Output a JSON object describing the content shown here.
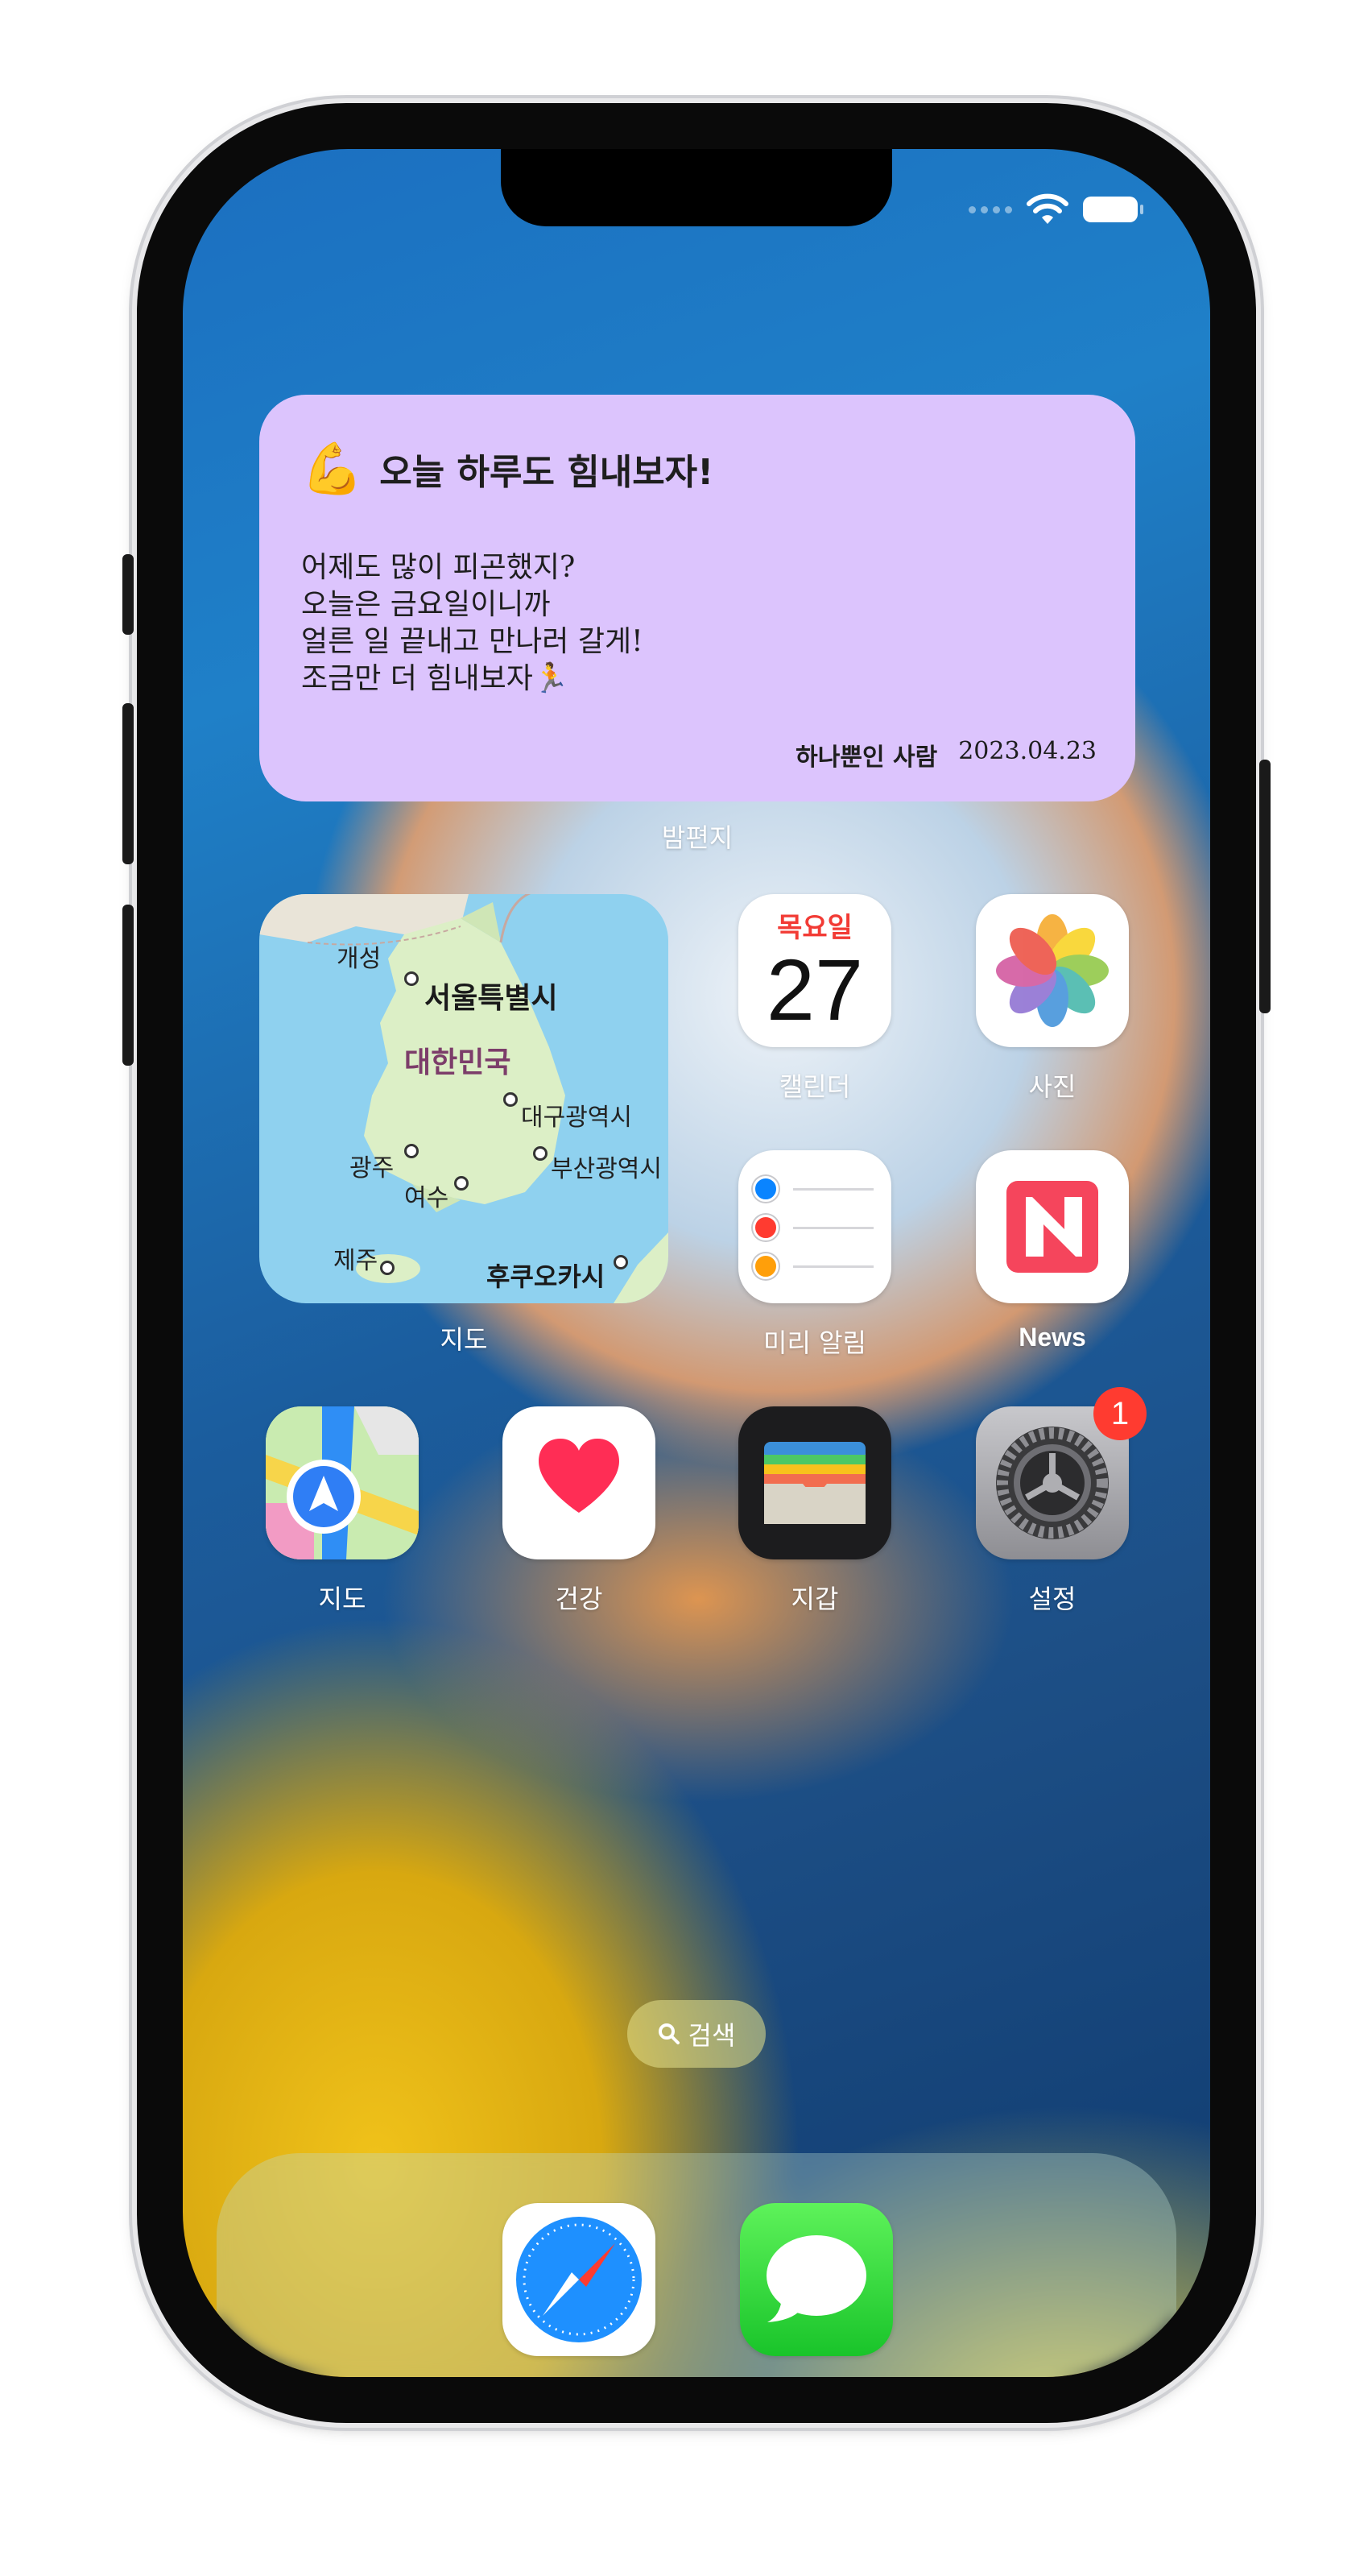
{
  "status": {
    "wifi_icon": "wifi-icon",
    "battery_icon": "battery-icon"
  },
  "letter_widget": {
    "emoji": "💪",
    "title": "오늘 하루도 힘내보자!",
    "lines": [
      "어제도 많이 피곤했지?",
      "오늘은 금요일이니까",
      "얼른 일 끝내고 만나러 갈게!",
      "조금만 더 힘내보자🏃"
    ],
    "signature": "하나뿐인 사람",
    "date": "2023.04.23",
    "label": "밤편지",
    "color": "#dcc4fd"
  },
  "map_widget": {
    "label": "지도",
    "places": {
      "kaesong": "개성",
      "seoul": "서울특별시",
      "country": "대한민국",
      "daegu": "대구광역시",
      "gwangju": "광주",
      "busan": "부산광역시",
      "yeosu": "여수",
      "jeju": "제주",
      "fukuoka": "후쿠오카시"
    }
  },
  "apps": {
    "calendar": {
      "label": "캘린더",
      "day": "목요일",
      "date": "27"
    },
    "photos": {
      "label": "사진"
    },
    "reminders": {
      "label": "미리 알림"
    },
    "news": {
      "label": "News"
    },
    "maps": {
      "label": "지도"
    },
    "health": {
      "label": "건강"
    },
    "wallet": {
      "label": "지갑"
    },
    "settings": {
      "label": "설정",
      "badge": "1"
    }
  },
  "search": {
    "label": "검색"
  },
  "dock": {
    "apps": [
      "safari",
      "messages"
    ]
  }
}
